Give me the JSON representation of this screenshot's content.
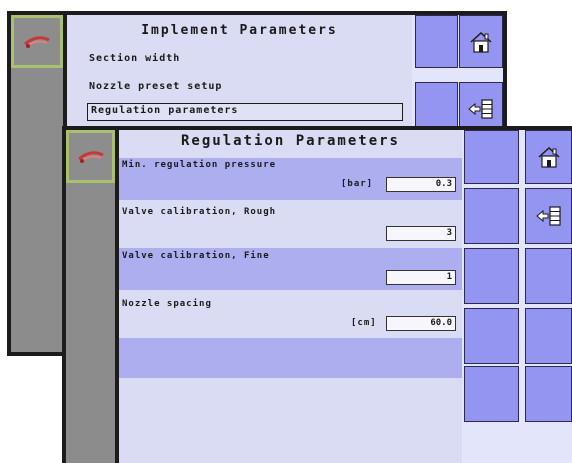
{
  "back_screen": {
    "title": "Implement Parameters",
    "menu": [
      {
        "label": "Section width"
      },
      {
        "label": "Nozzle preset setup"
      },
      {
        "label": "Regulation parameters"
      }
    ]
  },
  "front_screen": {
    "title": "Regulation Parameters",
    "params": [
      {
        "label": "Min. regulation pressure",
        "unit": "[bar]",
        "value": "0.3"
      },
      {
        "label": "Valve calibration, Rough",
        "unit": "",
        "value": "3"
      },
      {
        "label": "Valve calibration, Fine",
        "unit": "",
        "value": "1"
      },
      {
        "label": "Nozzle spacing",
        "unit": "[cm]",
        "value": "60.0"
      }
    ]
  },
  "icons": {
    "logo": "sprayer-logo-icon",
    "home": "home-icon",
    "back": "back-list-icon"
  },
  "colors": {
    "button": "#9495f0",
    "highlight_row": "#acaef0",
    "content_bg": "#d9dcf2",
    "logo_border": "#a8c070"
  }
}
